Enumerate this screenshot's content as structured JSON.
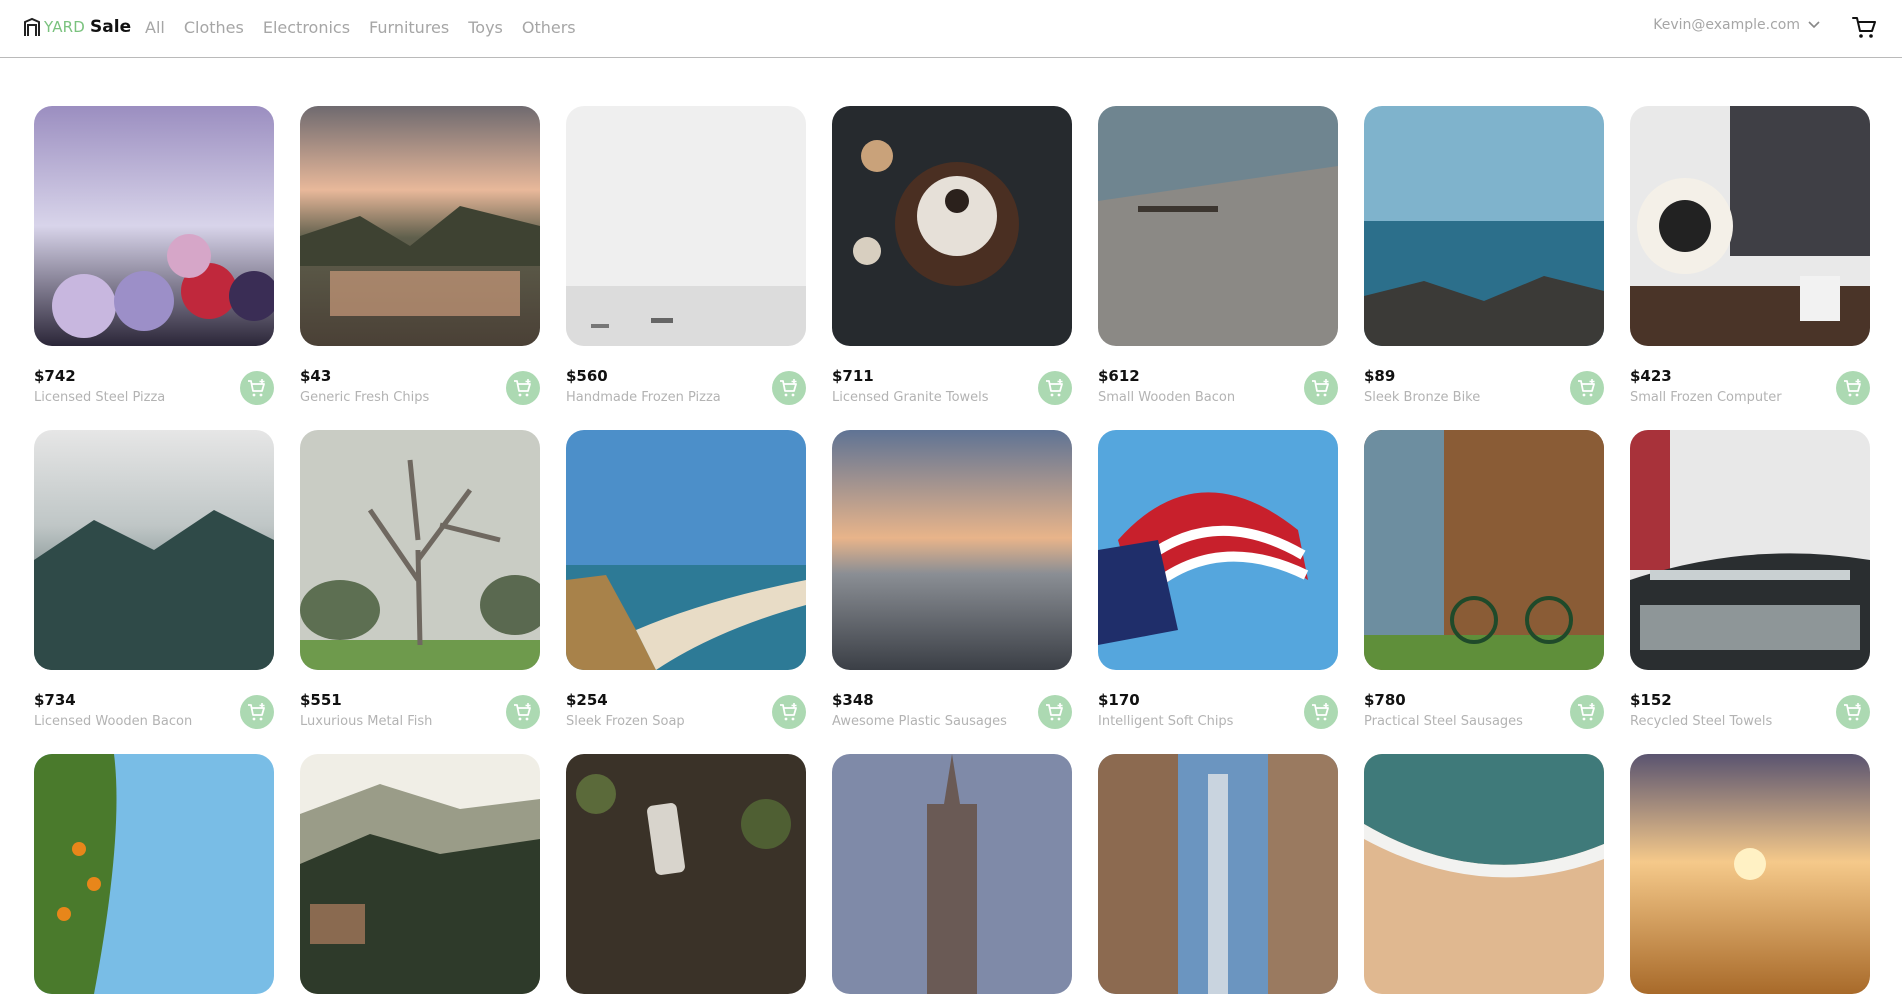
{
  "brand": {
    "part1": "YARD",
    "part2": "Sale",
    "accent": "#7ac27e"
  },
  "nav": [
    "All",
    "Clothes",
    "Electronics",
    "Furnitures",
    "Toys",
    "Others"
  ],
  "account": {
    "email": "Kevin@example.com"
  },
  "icons": {
    "cart": "shopping-cart-icon",
    "add": "add-to-cart-icon",
    "chevron": "chevron-down-icon"
  },
  "products": [
    {
      "price": "$742",
      "name": "Licensed Steel Pizza"
    },
    {
      "price": "$43",
      "name": "Generic Fresh Chips"
    },
    {
      "price": "$560",
      "name": "Handmade Frozen Pizza"
    },
    {
      "price": "$711",
      "name": "Licensed Granite Towels"
    },
    {
      "price": "$612",
      "name": "Small Wooden Bacon"
    },
    {
      "price": "$89",
      "name": "Sleek Bronze Bike"
    },
    {
      "price": "$423",
      "name": "Small Frozen Computer"
    },
    {
      "price": "$734",
      "name": "Licensed Wooden Bacon"
    },
    {
      "price": "$551",
      "name": "Luxurious Metal Fish"
    },
    {
      "price": "$254",
      "name": "Sleek Frozen Soap"
    },
    {
      "price": "$348",
      "name": "Awesome Plastic Sausages"
    },
    {
      "price": "$170",
      "name": "Intelligent Soft Chips"
    },
    {
      "price": "$780",
      "name": "Practical Steel Sausages"
    },
    {
      "price": "$152",
      "name": "Recycled Steel Towels"
    },
    {
      "price": "",
      "name": ""
    },
    {
      "price": "",
      "name": ""
    },
    {
      "price": "",
      "name": ""
    },
    {
      "price": "",
      "name": ""
    },
    {
      "price": "",
      "name": ""
    },
    {
      "price": "",
      "name": ""
    },
    {
      "price": "",
      "name": ""
    }
  ]
}
